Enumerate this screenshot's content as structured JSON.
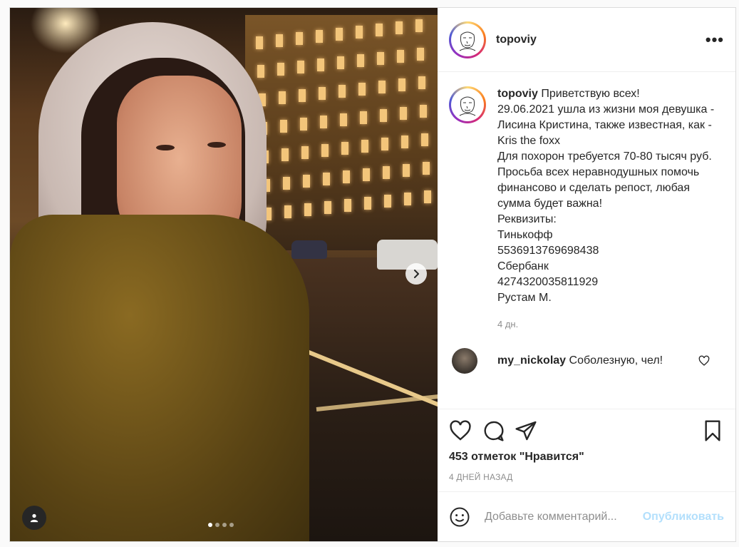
{
  "post": {
    "author": "topoviy",
    "more_icon": "more-horizontal-icon",
    "caption": "Приветствую всех!\n29.06.2021 ушла из жизни моя девушка - Лисина Кристина, также известная, как - Kris the foxx\nДля похорон требуется 70-80 тысяч руб.\nПросьба всех неравнодушных помочь финансово и сделать репост, любая сумма будет важна!\nРеквизиты:\nТинькофф\n5536913769698438\nСбербанк\n4274320035811929\nРустам М.",
    "caption_time": "4 дн.",
    "comments": [
      {
        "user": "my_nickolay",
        "text": "Соболезную, чел!"
      }
    ],
    "likes": "453 отметок \"Нравится\"",
    "date": "4 ДНЕЙ НАЗАД",
    "comment_placeholder": "Добавьте комментарий...",
    "publish_label": "Опубликовать",
    "carousel": {
      "total": 4,
      "active": 0
    },
    "colors": {
      "accent": "#0095f6",
      "publish_disabled": "#b2dffc",
      "muted": "#8e8e8e",
      "border": "#dbdbdb"
    }
  }
}
